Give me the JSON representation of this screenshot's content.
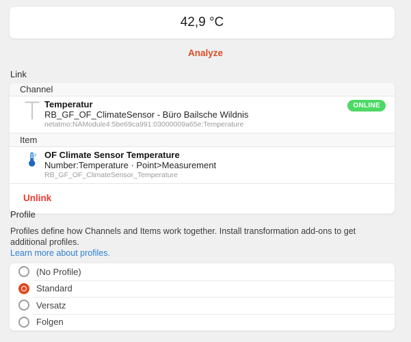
{
  "state_card": {
    "value": "42,9 °C"
  },
  "actions": {
    "analyze_label": "Analyze",
    "unlink_label": "Unlink"
  },
  "link_section": {
    "title": "Link",
    "channel_group_label": "Channel",
    "channel": {
      "title": "Temperatur",
      "subtitle": "RB_GF_OF_ClimateSensor - Büro Bailsche Wildnis",
      "uid": "netatmo:NAModule4:5be69ca991:03000009a65e:Temperature",
      "status_badge": "ONLINE",
      "icon": "channel-letter-icon"
    },
    "item_group_label": "Item",
    "item": {
      "title": "OF Climate Sensor Temperature",
      "subtitle": "Number:Temperature · Point>Measurement",
      "item_name": "RB_GF_OF_ClimateSensor_Temperature",
      "icon": "thermometer-icon"
    }
  },
  "profile_section": {
    "title": "Profile",
    "description": "Profiles define how Channels and Items work together. Install transformation add-ons to get additional profiles.",
    "learn_more_label": "Learn more about profiles.",
    "options": [
      {
        "label": "(No Profile)",
        "selected": false
      },
      {
        "label": "Standard",
        "selected": true
      },
      {
        "label": "Versatz",
        "selected": false
      },
      {
        "label": "Folgen",
        "selected": false
      }
    ]
  },
  "colors": {
    "accent_orange": "#dd4a22",
    "unlink_red": "#f5372c",
    "link_blue": "#2e7fd0",
    "online_green": "#4cd964",
    "page_background": "#f0f0f1"
  }
}
